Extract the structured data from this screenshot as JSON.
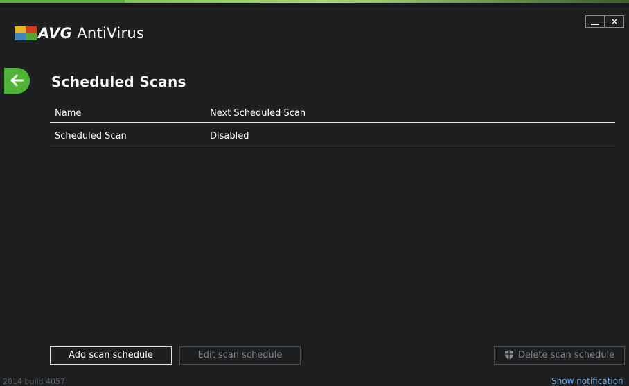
{
  "window": {
    "brand": "AVG",
    "product": "AntiVirus",
    "minimize_label": "",
    "close_label": "×"
  },
  "page": {
    "title": "Scheduled Scans"
  },
  "table": {
    "columns": [
      "Name",
      "Next Scheduled Scan"
    ],
    "rows": [
      {
        "name": "Scheduled Scan",
        "next": "Disabled"
      }
    ]
  },
  "buttons": {
    "add": "Add scan schedule",
    "edit": "Edit scan schedule",
    "delete": "Delete scan schedule"
  },
  "footer": {
    "build": "2014  build 4057",
    "notification": "Show notification"
  },
  "colors": {
    "background": "#1d1f21",
    "accent_green": "#4fb436",
    "link_blue": "#5da6e8",
    "disabled_text": "#7c7f82"
  },
  "icons": {
    "logo": "avg-logo-icon",
    "back": "back-arrow-icon",
    "delete": "shield-icon"
  }
}
